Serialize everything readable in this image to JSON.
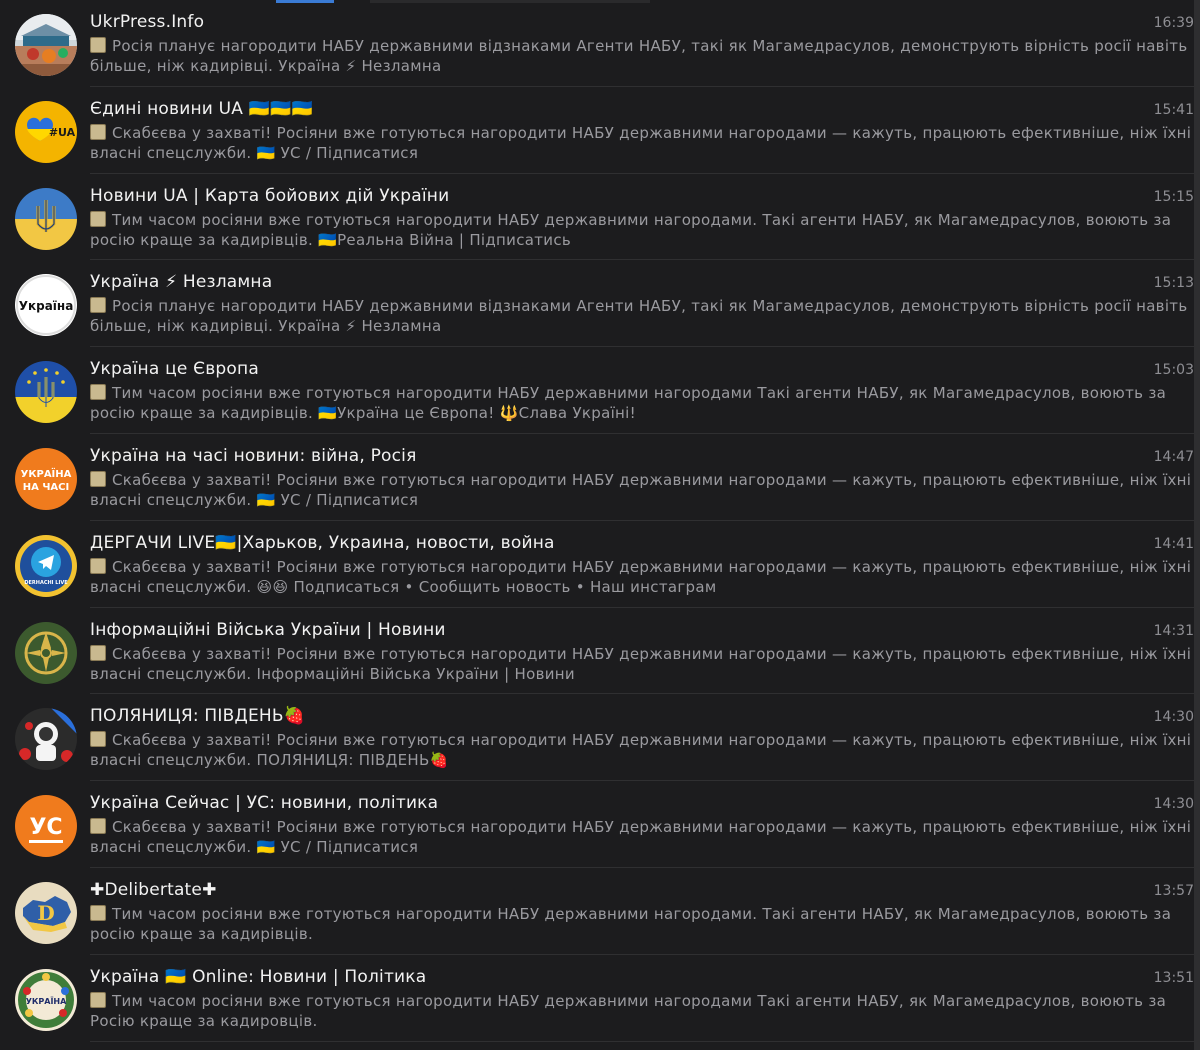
{
  "chats": [
    {
      "title": "UkrPress.Info",
      "time": "16:39",
      "preview": "Росія планує нагородити НАБУ державними відзнаками  Агенти НАБУ, такі як Магамедрасулов, демонструють вірність росії навіть більше, ніж кадирівці.  Україна ⚡ Незламна",
      "avatar_icon": "photo-avatar-icon"
    },
    {
      "title": "Єдині новини UA 🇺🇦🇺🇦🇺🇦",
      "time": "15:41",
      "preview": "Скабєєва у захваті!  Росіяни вже готуються нагородити НАБУ державними нагородами — кажуть, працюють ефективніше, ніж їхні власні спецслужби.  🇺🇦 УС / Підписатися",
      "avatar_icon": "heart-ua-avatar-icon",
      "avatar_text": "#UA"
    },
    {
      "title": "Новини UA | Карта бойових дій України",
      "time": "15:15",
      "preview": "Тим часом росіяни вже готуються нагородити НАБУ державними нагородами.  Такі агенти НАБУ, як Магамедрасулов, воюють за росію краще за кадирівців.  🇺🇦Реальна Війна | Підписатись",
      "avatar_icon": "trident-flag-avatar-icon"
    },
    {
      "title": "Україна ⚡ Незламна",
      "time": "15:13",
      "preview": "Росія планує нагородити НАБУ державними відзнаками  Агенти НАБУ, такі як Магамедрасулов, демонструють вірність росії навіть більше, ніж кадирівці.  Україна ⚡ Незламна",
      "avatar_icon": "text-logo-avatar-icon",
      "avatar_text": "Україна"
    },
    {
      "title": "Україна це Європа",
      "time": "15:03",
      "preview": "Тим часом росіяни вже готуються нагородити НАБУ державними нагородами  Такі агенти НАБУ, як Магамедрасулов, воюють за росію краще за кадирівців.  🇺🇦Україна це Європа! 🔱Слава Україні!",
      "avatar_icon": "eu-trident-avatar-icon"
    },
    {
      "title": "Україна на часі новини: війна, Росія",
      "time": "14:47",
      "preview": "Скабєєва у захваті!  Росіяни вже готуються нагородити НАБУ державними нагородами — кажуть, працюють ефективніше, ніж їхні власні спецслужби.  🇺🇦 УС / Підписатися",
      "avatar_icon": "orange-text-avatar-icon",
      "avatar_text": "УКРАЇНА НА ЧАСІ"
    },
    {
      "title": "ДЕРГАЧИ LIVE🇺🇦|Харьков, Украина, новости, война",
      "time": "14:41",
      "preview": "Скабєєва у захваті!  Росіяни вже готуються нагородити НАБУ державними нагородами — кажуть, працюють ефективніше, ніж їхні власні спецслужби.  😆😆  Подписаться • Сообщить новость • Наш инстаграм",
      "avatar_icon": "telegram-badge-avatar-icon",
      "avatar_text": "DERHACHI LIVE"
    },
    {
      "title": "Інформаційні Війська України | Новини",
      "time": "14:31",
      "preview": "Скабєєва у захваті!  Росіяни вже готуються нагородити НАБУ державними нагородами — кажуть, працюють ефективніше, ніж їхні власні спецслужби.  Інформаційні Війська України | Новини",
      "avatar_icon": "military-emblem-avatar-icon"
    },
    {
      "title": "ПОЛЯНИЦЯ: ПІВДЕНЬ🍓",
      "time": "14:30",
      "preview": "Скабєєва у захваті!  Росіяни вже готуються нагородити НАБУ державними нагородами — кажуть, працюють ефективніше, ніж їхні власні спецслужби.  ПОЛЯНИЦЯ: ПІВДЕНЬ🍓",
      "avatar_icon": "astronaut-avatar-icon"
    },
    {
      "title": "Україна Сейчас | УС: новини, політика",
      "time": "14:30",
      "preview": "Скабєєва у захваті!  Росіяни вже готуються нагородити НАБУ державними нагородами — кажуть, працюють ефективніше, ніж їхні власні спецслужби.  🇺🇦 УС / Підписатися",
      "avatar_icon": "us-logo-avatar-icon",
      "avatar_text": "УС"
    },
    {
      "title": "✚Delibertate✚",
      "time": "13:57",
      "preview": "Тим часом росіяни вже готуються нагородити НАБУ державними нагородами.  Такі агенти НАБУ, як Магамедрасулов, воюють за росію краще за кадирівців.",
      "avatar_icon": "map-d-avatar-icon"
    },
    {
      "title": "Україна 🇺🇦 Online: Новини | Політика",
      "time": "13:51",
      "preview": "Тим часом росіяни вже готуються нагородити НАБУ державними нагородами  Такі агенти НАБУ, як Магамедрасулов, воюють за Росію краще за кадировців.",
      "avatar_icon": "wreath-avatar-icon",
      "avatar_text": "УКРАЇНА"
    }
  ]
}
